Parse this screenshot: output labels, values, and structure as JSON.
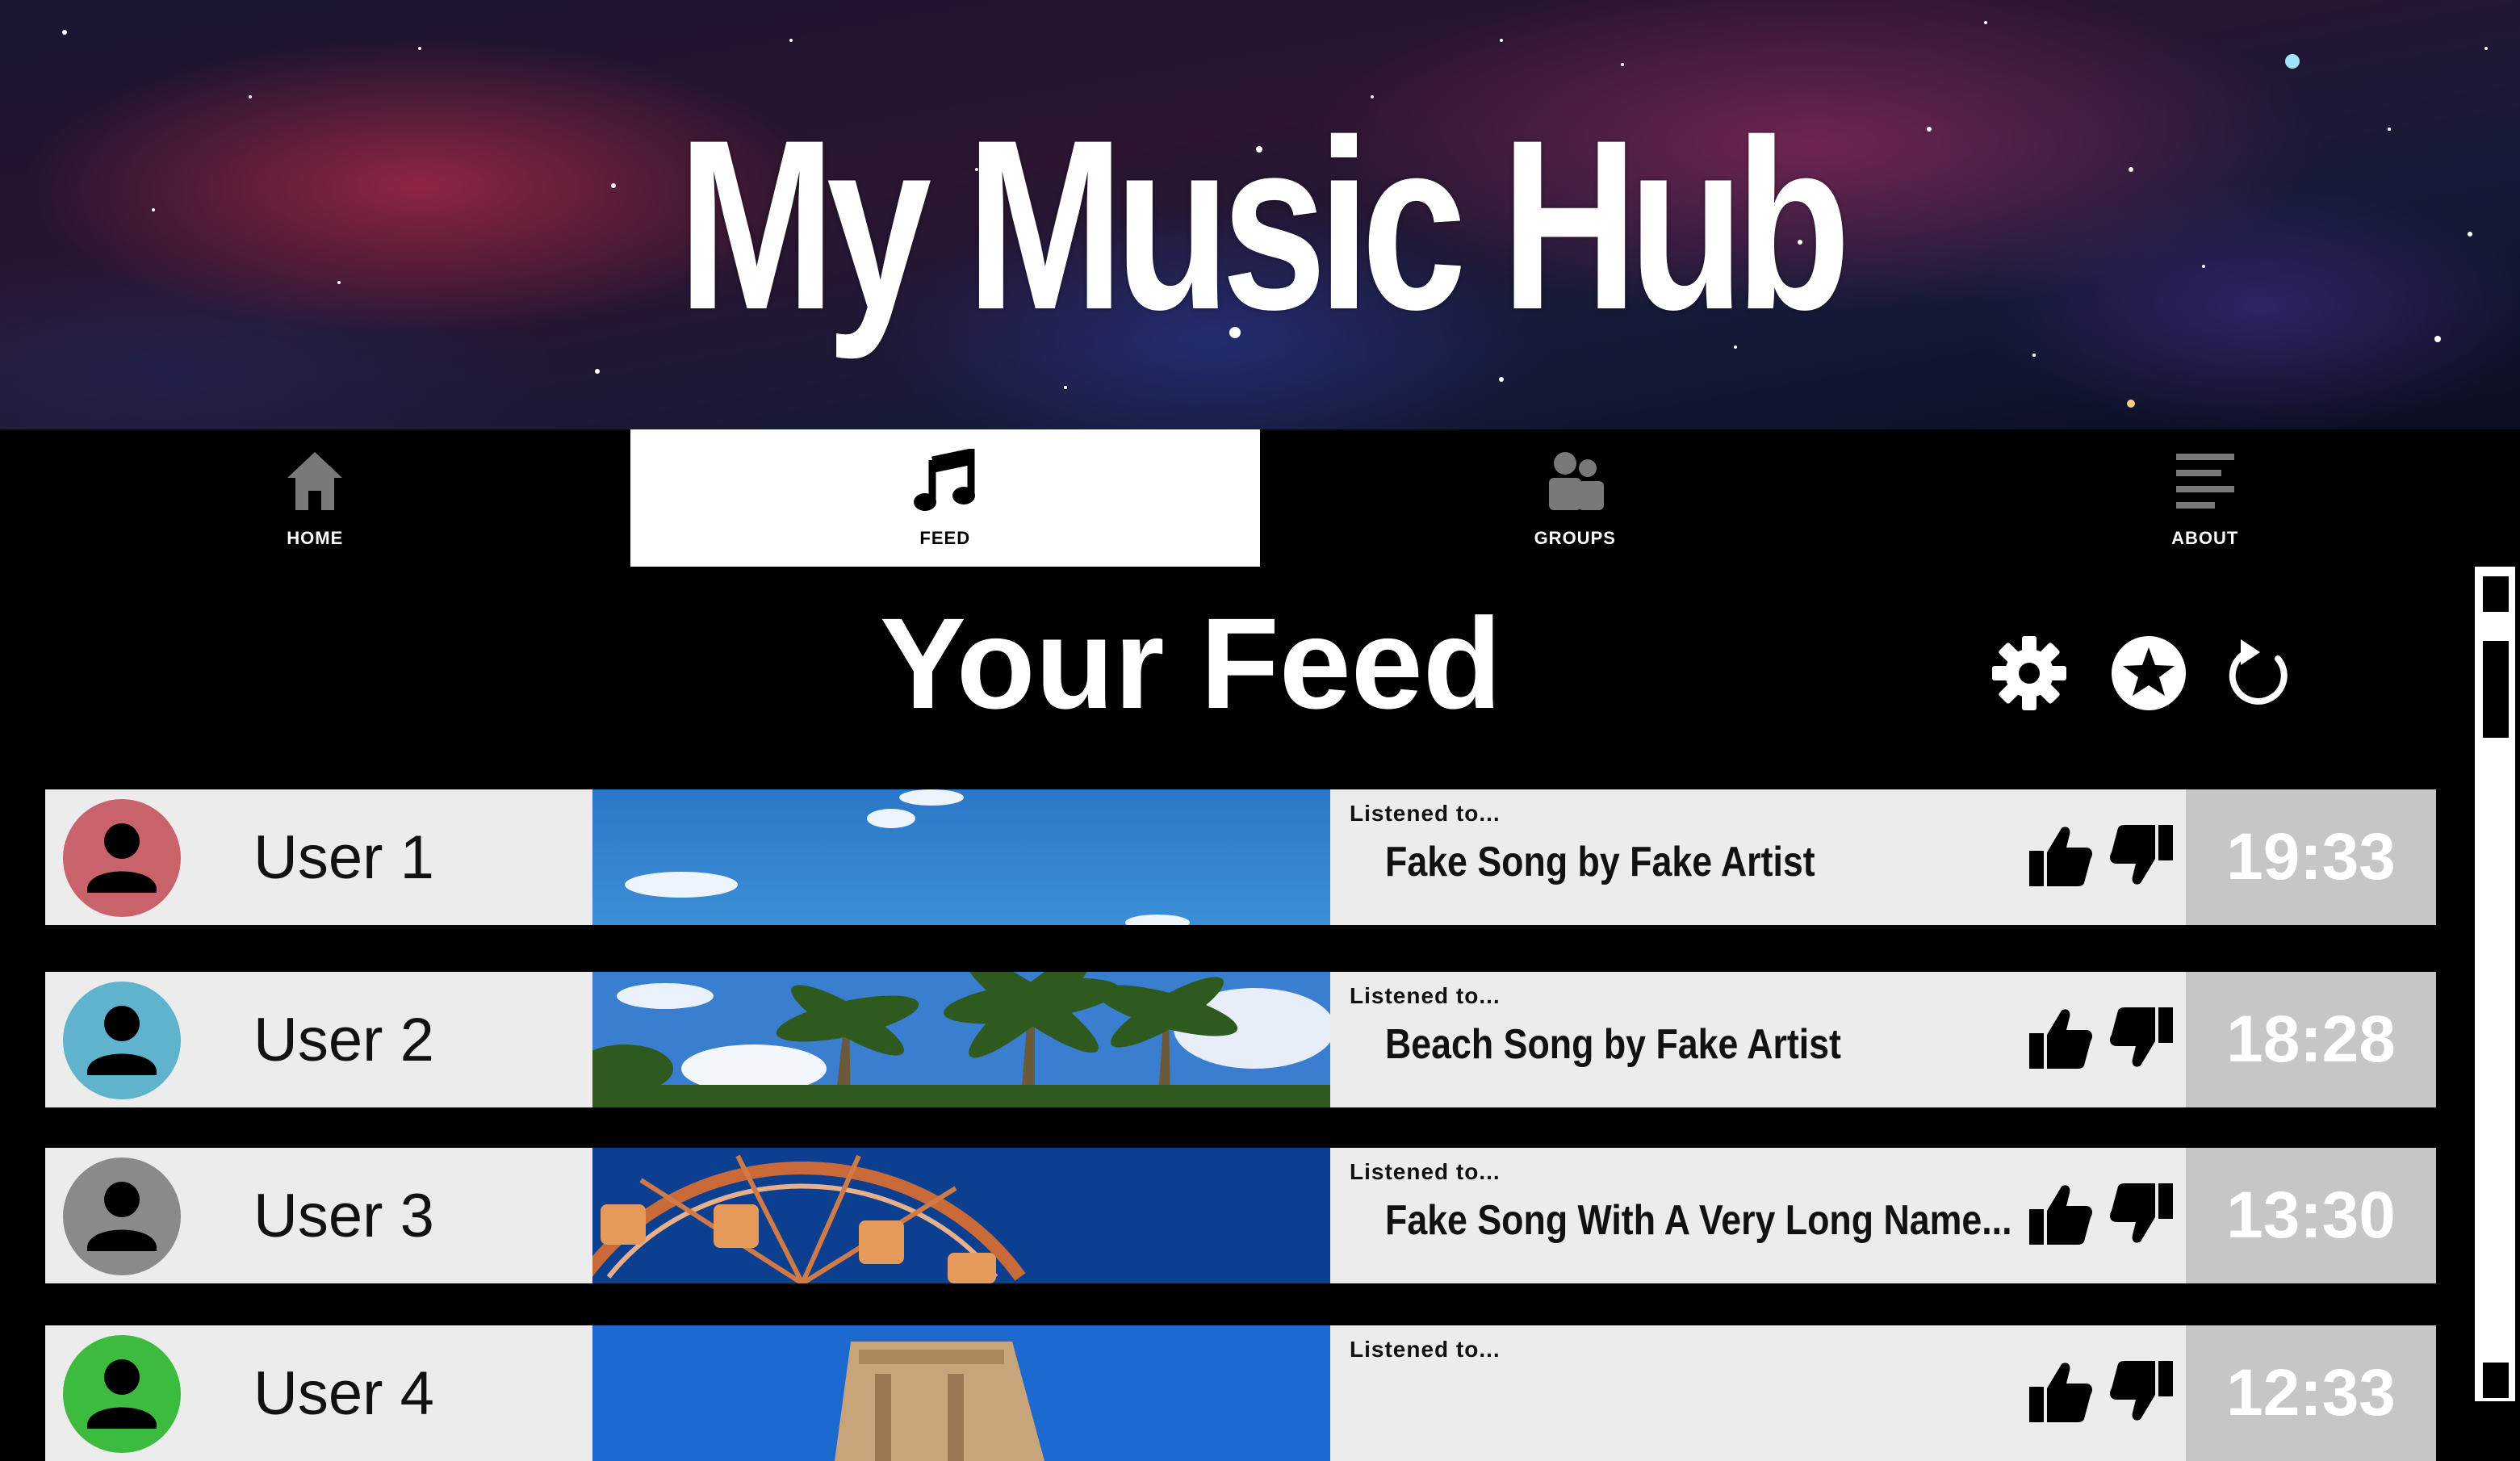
{
  "app": {
    "title": "My Music Hub"
  },
  "nav": {
    "items": [
      {
        "label": "HOME",
        "icon": "home-icon",
        "active": false
      },
      {
        "label": "FEED",
        "icon": "music-note-icon",
        "active": true
      },
      {
        "label": "GROUPS",
        "icon": "group-icon",
        "active": false
      },
      {
        "label": "ABOUT",
        "icon": "about-lines-icon",
        "active": false
      }
    ]
  },
  "feed": {
    "title": "Your Feed",
    "tools": [
      {
        "icon": "gear-icon"
      },
      {
        "icon": "star-circle-icon"
      },
      {
        "icon": "refresh-icon"
      }
    ],
    "entries": [
      {
        "user": "User 1",
        "avatar_color": "#c9636b",
        "image": "sky-clouds",
        "listened_label": "Listened to...",
        "song": "Fake Song by Fake Artist",
        "time": "19:33"
      },
      {
        "user": "User 2",
        "avatar_color": "#5fb3cc",
        "image": "palm-trees",
        "listened_label": "Listened to...",
        "song": "Beach Song by Fake Artist",
        "time": "18:28"
      },
      {
        "user": "User 3",
        "avatar_color": "#8a8a8a",
        "image": "ferris-wheel",
        "listened_label": "Listened to...",
        "song": "Fake Song With A Very Long Name...",
        "time": "13:30"
      },
      {
        "user": "User 4",
        "avatar_color": "#3dbb3f",
        "image": "stone-temple",
        "listened_label": "Listened to...",
        "song": "",
        "time": "12:33"
      }
    ]
  },
  "colors": {
    "card_bg": "#ececec",
    "time_bg": "#c6c6c6",
    "page_bg": "#000000"
  }
}
